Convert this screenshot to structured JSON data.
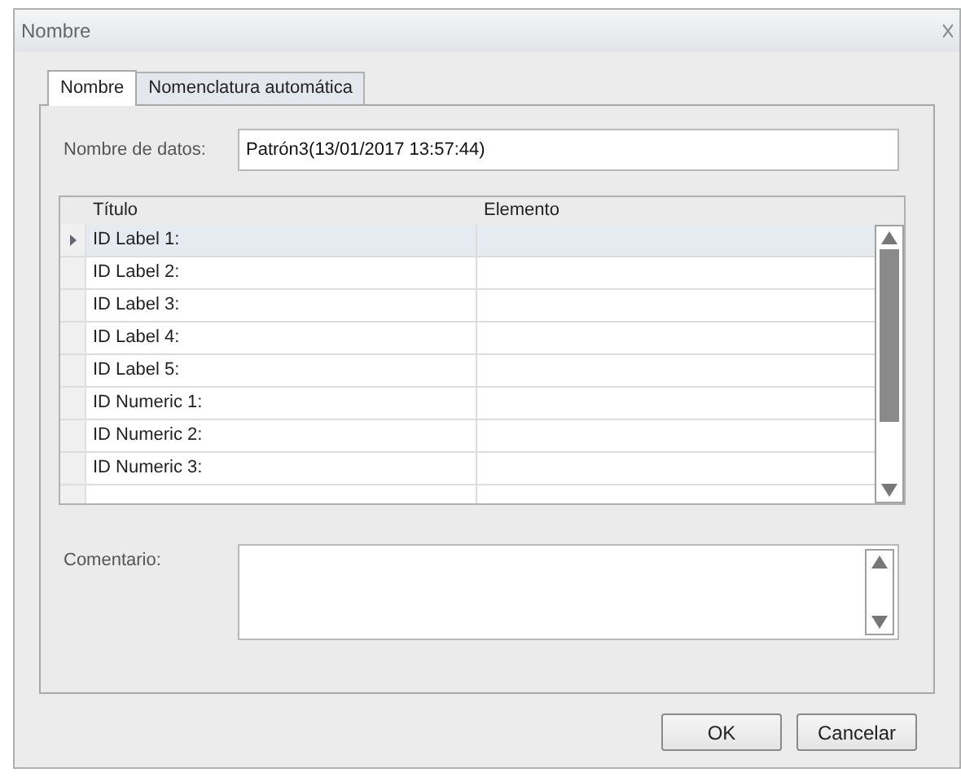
{
  "window": {
    "title": "Nombre"
  },
  "tabs": [
    {
      "label": "Nombre",
      "selected": true
    },
    {
      "label": "Nomenclatura automática",
      "selected": false
    }
  ],
  "data_name": {
    "label": "Nombre de datos:",
    "value": "Patrón3(13/01/2017 13:57:44)"
  },
  "table": {
    "columns": [
      "Título",
      "Elemento"
    ],
    "rows": [
      {
        "title": "ID Label 1:",
        "selected": true
      },
      {
        "title": "ID Label 2:",
        "selected": false
      },
      {
        "title": "ID Label 3:",
        "selected": false
      },
      {
        "title": "ID Label 4:",
        "selected": false
      },
      {
        "title": "ID Label 5:",
        "selected": false
      },
      {
        "title": "ID Numeric 1:",
        "selected": false
      },
      {
        "title": "ID Numeric 2:",
        "selected": false
      },
      {
        "title": "ID Numeric 3:",
        "selected": false
      }
    ]
  },
  "comment": {
    "label": "Comentario:"
  },
  "buttons": [
    "OK",
    "Cancelar"
  ]
}
